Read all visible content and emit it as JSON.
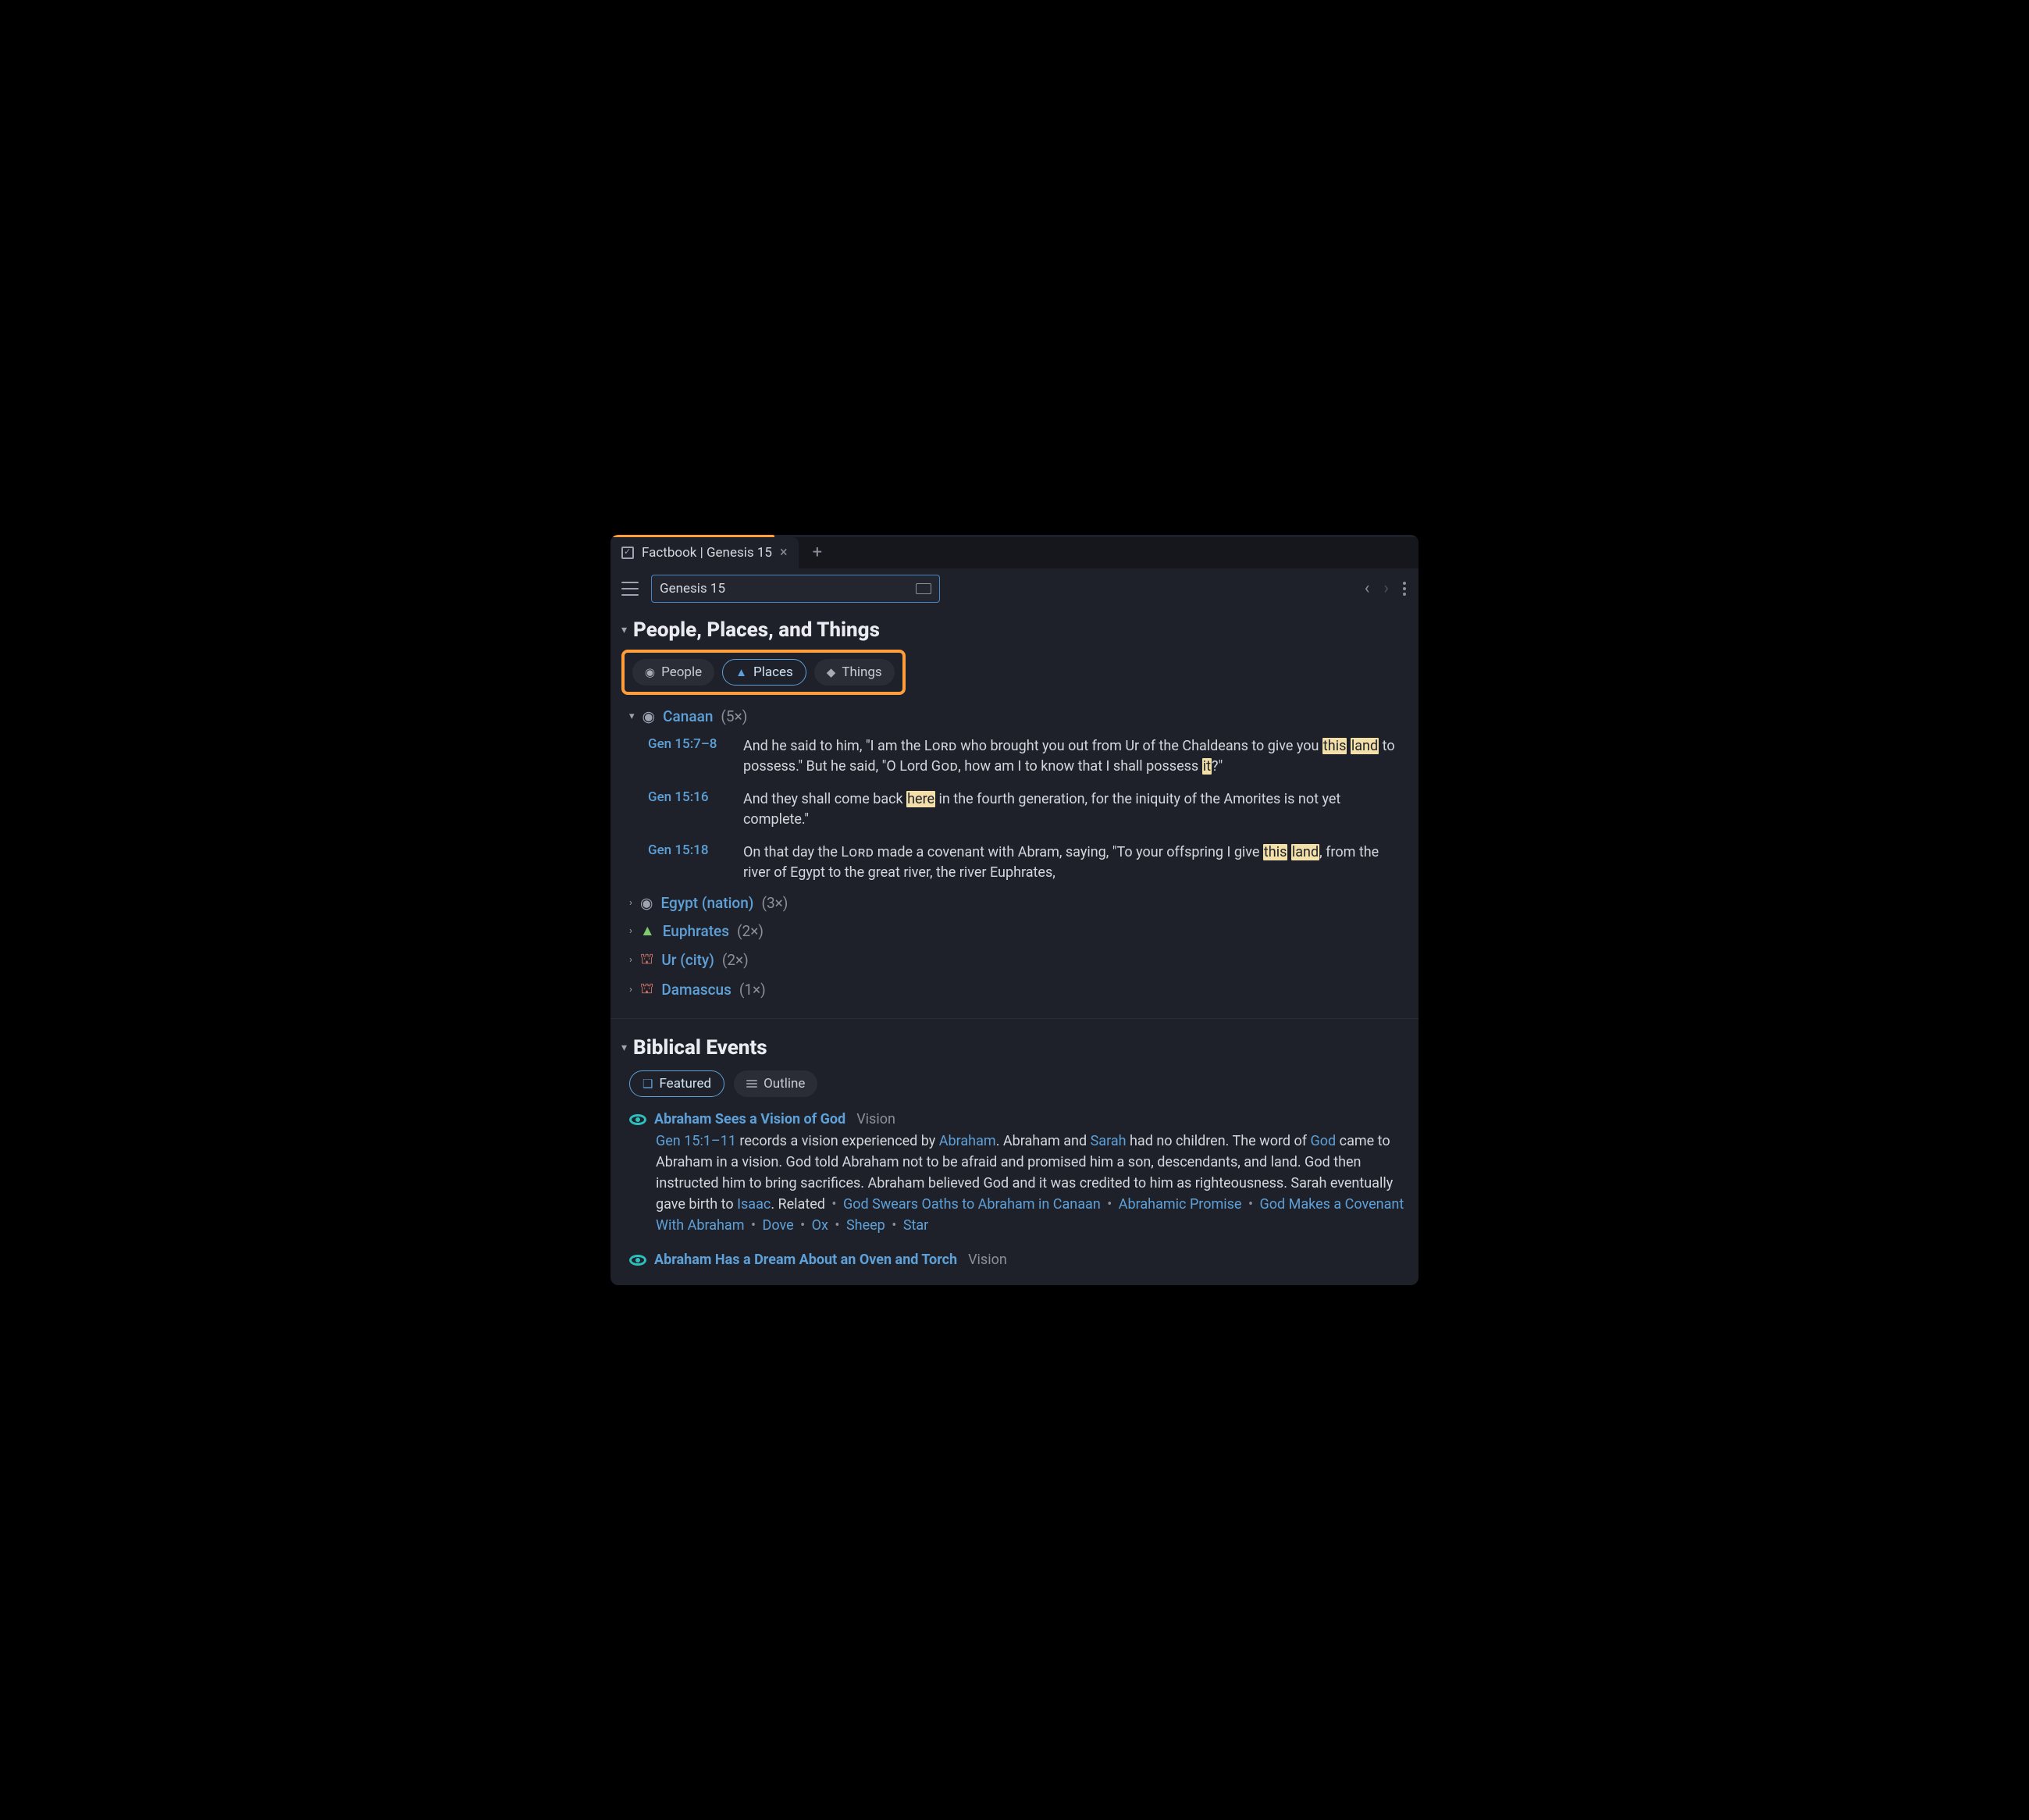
{
  "tab": {
    "title": "Factbook | Genesis 15"
  },
  "search": {
    "value": "Genesis 15"
  },
  "sections": {
    "ppt": {
      "title": "People, Places, and Things",
      "filters": {
        "people": "People",
        "places": "Places",
        "things": "Things"
      }
    },
    "events": {
      "title": "Biblical Events",
      "filters": {
        "featured": "Featured",
        "outline": "Outline"
      }
    }
  },
  "places": [
    {
      "name": "Canaan",
      "count": "(5×)",
      "icon": "pin",
      "expanded": true,
      "verses": [
        {
          "ref": "Gen 15:7–8",
          "segments": [
            {
              "t": "And he said to him, \"I am the "
            },
            {
              "t": "Lord",
              "sc": true
            },
            {
              "t": " who brought you out from Ur of the Chaldeans to give you "
            },
            {
              "t": "this",
              "hl": true
            },
            {
              "t": " "
            },
            {
              "t": "land",
              "hl": true
            },
            {
              "t": " to possess.\" But he said, \"O Lord "
            },
            {
              "t": "God",
              "sc": true
            },
            {
              "t": ", how am I to know that I shall possess "
            },
            {
              "t": "it",
              "hl": true
            },
            {
              "t": "?\""
            }
          ]
        },
        {
          "ref": "Gen 15:16",
          "segments": [
            {
              "t": "And they shall come back "
            },
            {
              "t": "here",
              "hl": true
            },
            {
              "t": " in the fourth generation, for the iniquity of the Amorites is not yet complete.\""
            }
          ]
        },
        {
          "ref": "Gen 15:18",
          "segments": [
            {
              "t": "On that day the "
            },
            {
              "t": "Lord",
              "sc": true
            },
            {
              "t": " made a covenant with Abram, saying, \"To your offspring I give "
            },
            {
              "t": "this",
              "hl": true
            },
            {
              "t": " "
            },
            {
              "t": "land",
              "hl": true
            },
            {
              "t": ", from the river of Egypt to the great river, the river Euphrates,"
            }
          ]
        }
      ]
    },
    {
      "name": "Egypt (nation)",
      "count": "(3×)",
      "icon": "pin",
      "expanded": false
    },
    {
      "name": "Euphrates",
      "count": "(2×)",
      "icon": "mountain",
      "expanded": false
    },
    {
      "name": "Ur (city)",
      "count": "(2×)",
      "icon": "castle",
      "expanded": false
    },
    {
      "name": "Damascus",
      "count": "(1×)",
      "icon": "castle",
      "expanded": false
    }
  ],
  "events": [
    {
      "title": "Abraham Sees a Vision of God",
      "tag": "Vision",
      "body": [
        {
          "t": "Gen 15:1–11",
          "link": true
        },
        {
          "t": " records a vision experienced by "
        },
        {
          "t": "Abraham",
          "link": true
        },
        {
          "t": ". Abraham and "
        },
        {
          "t": "Sarah",
          "link": true
        },
        {
          "t": " had no children. The word of "
        },
        {
          "t": "God",
          "link": true
        },
        {
          "t": " came to Abraham in a vision. God told Abraham not to be afraid and promised him a son, descendants, and land. God then instructed him to bring sacrifices. Abraham believed God and it was credited to him as righteousness. Sarah eventually gave birth to "
        },
        {
          "t": "Isaac",
          "link": true
        },
        {
          "t": ". Related"
        },
        {
          "t": " • ",
          "sep": true
        },
        {
          "t": "God Swears Oaths to Abraham in Canaan",
          "link": true
        },
        {
          "t": " • ",
          "sep": true
        },
        {
          "t": "Abrahamic Promise",
          "link": true
        },
        {
          "t": " • ",
          "sep": true
        },
        {
          "t": "God Makes a Covenant With Abraham",
          "link": true
        },
        {
          "t": " • ",
          "sep": true
        },
        {
          "t": "Dove",
          "link": true
        },
        {
          "t": " • ",
          "sep": true
        },
        {
          "t": "Ox",
          "link": true
        },
        {
          "t": " • ",
          "sep": true
        },
        {
          "t": "Sheep",
          "link": true
        },
        {
          "t": " • ",
          "sep": true
        },
        {
          "t": "Star",
          "link": true
        }
      ]
    },
    {
      "title": "Abraham Has a Dream About an Oven and Torch",
      "tag": "Vision",
      "body": null
    }
  ]
}
